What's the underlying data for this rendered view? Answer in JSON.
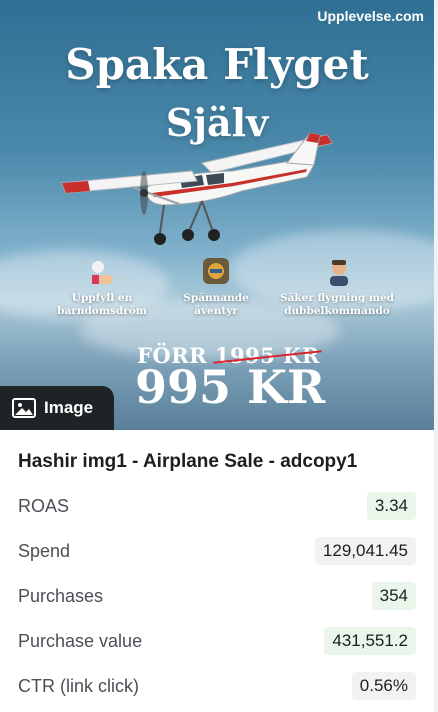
{
  "brand": "Upplevelse.com",
  "headline": {
    "line1": "Spaka Flyget",
    "line2": "Själv"
  },
  "features": [
    {
      "icon": "hand-gift-icon",
      "text": "Uppfyll en barndomsdröm"
    },
    {
      "icon": "adventure-app-icon",
      "text": "Spännande äventyr"
    },
    {
      "icon": "pilot-icon",
      "text": "Säker flygning med dubbelkommando"
    }
  ],
  "price": {
    "prefix": "FÖRR",
    "old": "1995 KR",
    "new": "995 KR"
  },
  "badge": {
    "icon": "image-icon",
    "label": "Image"
  },
  "ad_title": "Hashir img1 - Airplane Sale - adcopy1",
  "metrics": [
    {
      "label": "ROAS",
      "value": "3.34",
      "style": "green"
    },
    {
      "label": "Spend",
      "value": "129,041.45",
      "style": "grey"
    },
    {
      "label": "Purchases",
      "value": "354",
      "style": "green"
    },
    {
      "label": "Purchase value",
      "value": "431,551.2",
      "style": "green"
    },
    {
      "label": "CTR (link click)",
      "value": "0.56%",
      "style": "grey"
    }
  ],
  "colors": {
    "strike": "#d9262c",
    "badge_bg": "#1f2326",
    "value_green_bg": "#eaf6e9",
    "value_grey_bg": "#f2f2f2"
  }
}
